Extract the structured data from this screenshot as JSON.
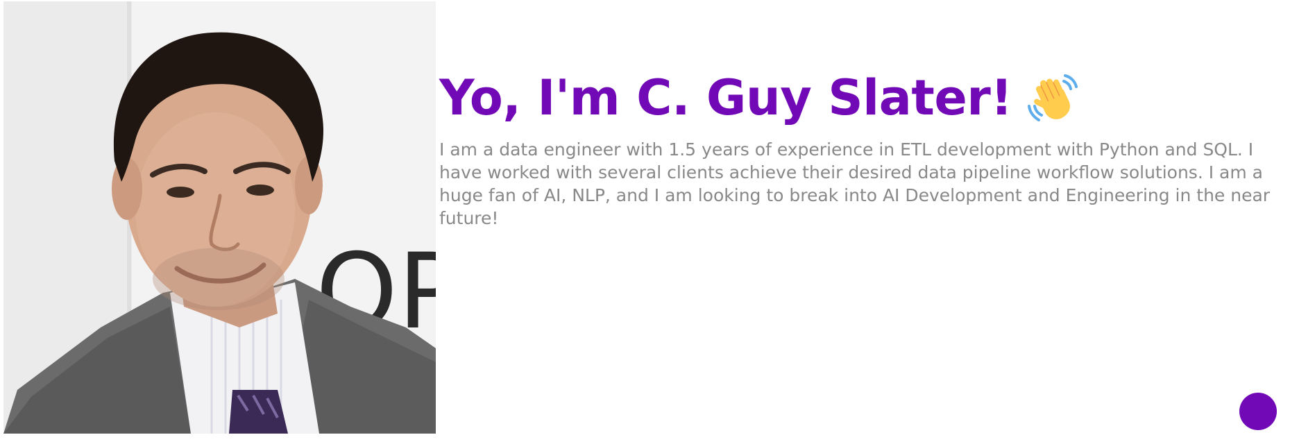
{
  "hero": {
    "photo": {
      "icon": "portrait-photo",
      "watermark_text": "OP"
    },
    "headline": "Yo, I'm C. Guy Slater!",
    "headline_icon": "waving-hand-icon",
    "bio": "I am a data engineer with 1.5 years of experience in ETL development with Python and SQL. I have worked with several clients achieve their desired data pipeline workflow solutions. I am a huge fan of AI, NLP, and I am looking to break into AI Development and Engineering in the near future!"
  },
  "floating_button": {
    "icon": "circle-button",
    "color": "#7209b7"
  },
  "colors": {
    "accent": "#7209b7",
    "body_text": "#888888",
    "background": "#ffffff"
  }
}
